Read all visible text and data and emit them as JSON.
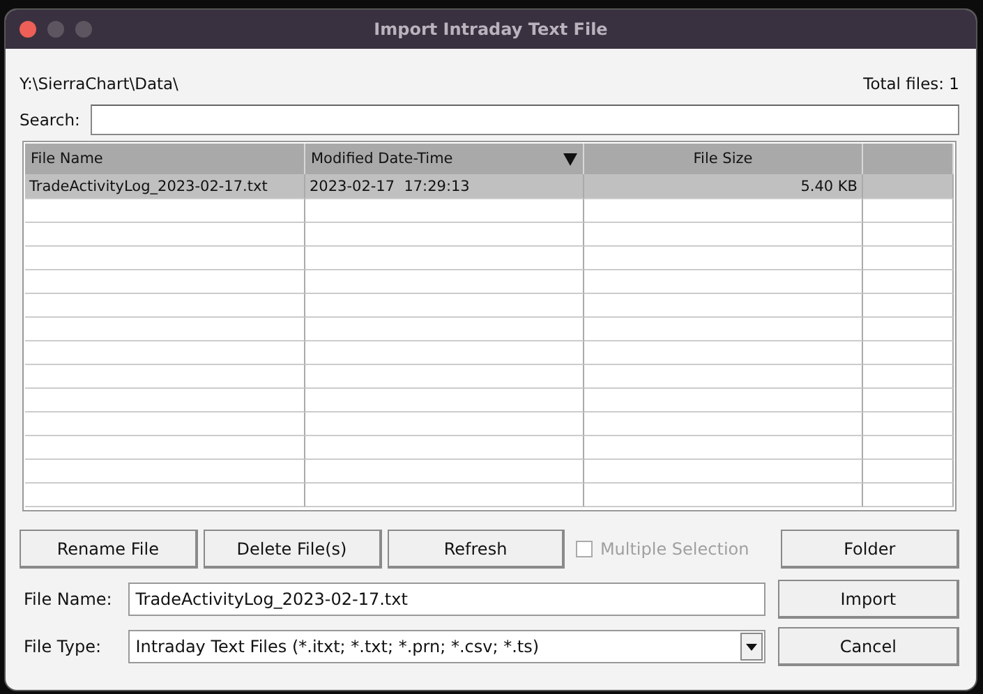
{
  "window": {
    "title": "Import Intraday Text File"
  },
  "path": "Y:\\SierraChart\\Data\\",
  "total_files": "Total files: 1",
  "search": {
    "label": "Search:"
  },
  "table": {
    "columns": [
      {
        "label": "File Name",
        "sorted": false
      },
      {
        "label": "Modified Date-Time",
        "sorted": true
      },
      {
        "label": "File Size",
        "sorted": false
      }
    ],
    "rows": [
      {
        "name": "TradeActivityLog_2023-02-17.txt",
        "modified": "2023-02-17  17:29:13",
        "size": "5.40 KB",
        "selected": true
      }
    ]
  },
  "buttons": [
    {
      "label": "Rename File"
    },
    {
      "label": "Delete File(s)"
    },
    {
      "label": "Refresh"
    }
  ],
  "multiple_selection": {
    "label": "Multiple Selection",
    "checked": false,
    "disabled": true
  },
  "folder_button": "Folder",
  "file_name": {
    "label": "File Name:",
    "value": "TradeActivityLog_2023-02-17.txt"
  },
  "file_type": {
    "label": "File Type:",
    "value": "Intraday Text Files (*.itxt; *.txt; *.prn; *.csv; *.ts)"
  },
  "import_button": "Import",
  "cancel_button": "Cancel"
}
